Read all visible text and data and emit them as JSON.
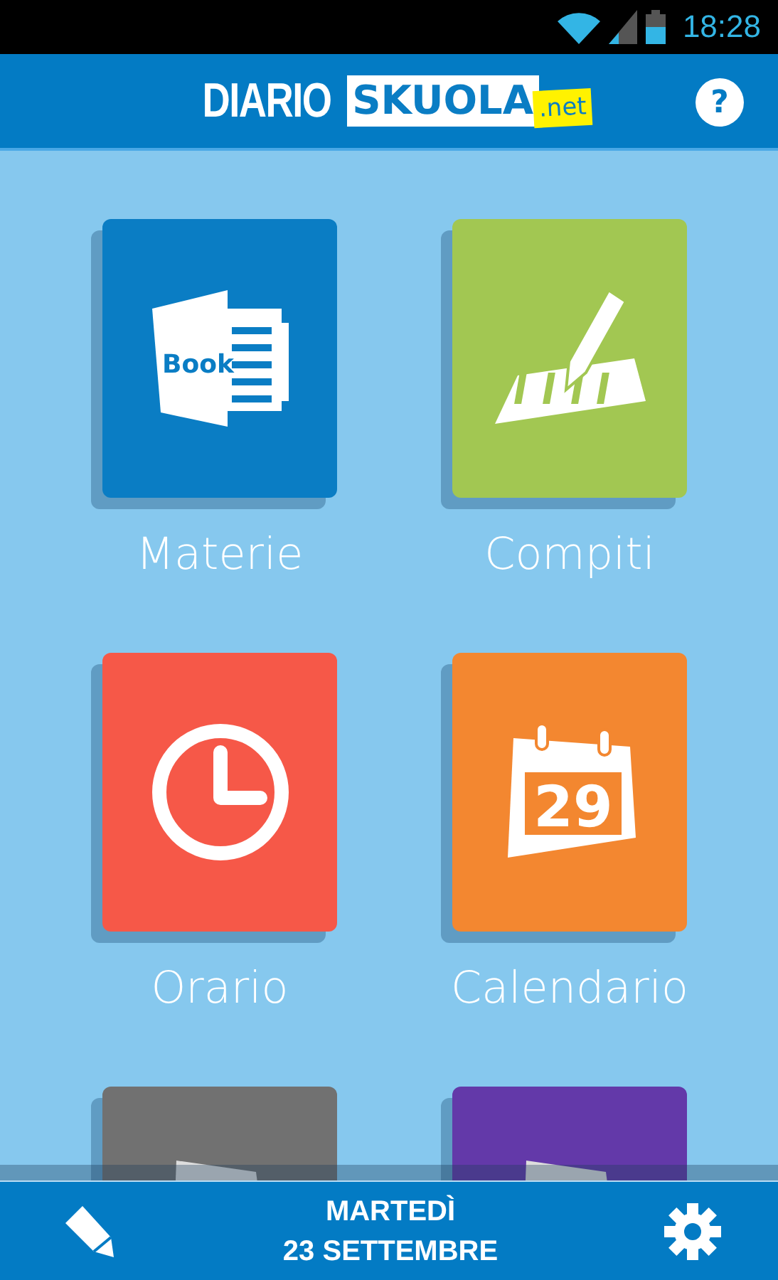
{
  "status_bar": {
    "time": "18:28"
  },
  "header": {
    "logo": {
      "word": "DIARIO",
      "brand": "SKUOLA",
      "suffix": ".net"
    },
    "help": "?"
  },
  "tiles": [
    {
      "label": "Materie",
      "color": "#0a7dc4",
      "kind": "book",
      "book_text": "Book"
    },
    {
      "label": "Compiti",
      "color": "#a2c752",
      "kind": "pencil"
    },
    {
      "label": "Orario",
      "color": "#f65848",
      "kind": "clock"
    },
    {
      "label": "Calendario",
      "color": "#f38730",
      "kind": "calendar",
      "day": "29"
    },
    {
      "color": "#717171",
      "kind": "note"
    },
    {
      "color": "#6339a9",
      "kind": "note"
    }
  ],
  "bottom_bar": {
    "day": "MARTEDÌ",
    "date": "23 SETTEMBRE"
  }
}
